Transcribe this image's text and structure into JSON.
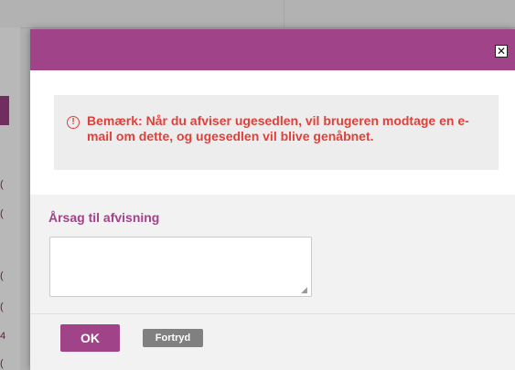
{
  "background": {
    "left_marks": [
      "(",
      "(",
      "(",
      "(",
      "4",
      "("
    ]
  },
  "modal": {
    "close_label": "✕",
    "warning": {
      "icon_label": "!",
      "text": "Bemærk: Når du afviser ugesedlen, vil brugeren modtage en e-mail om dette, og ugesedlen vil blive genåbnet."
    },
    "reason": {
      "label": "Årsag til afvisning",
      "value": ""
    },
    "buttons": {
      "ok": "OK",
      "cancel": "Fortryd"
    }
  },
  "colors": {
    "accent": "#a14389",
    "warning": "#e0403a",
    "cancel_button": "#808080"
  }
}
